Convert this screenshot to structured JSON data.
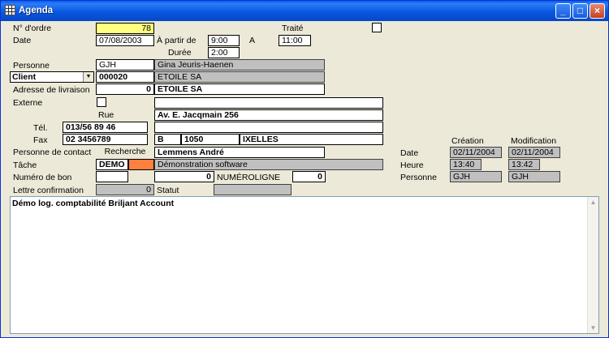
{
  "window": {
    "title": "Agenda"
  },
  "labels": {
    "order": "N° d'ordre",
    "traite": "Traité",
    "date": "Date",
    "a_partir": "À partir de",
    "a": "A",
    "duree": "Durée",
    "personne": "Personne",
    "adresse_livraison": "Adresse de livraison",
    "externe": "Externe",
    "rue": "Rue",
    "tel": "Tél.",
    "fax": "Fax",
    "contact": "Personne de contact",
    "tache": "Tâche",
    "num_bon": "Numéro de bon",
    "numeroligne": "NUMÉROLIGNE",
    "lettre": "Lettre confirmation",
    "statut": "Statut",
    "creation": "Création",
    "modification": "Modification",
    "meta_date": "Date",
    "meta_heure": "Heure",
    "meta_personne": "Personne"
  },
  "values": {
    "order": "78",
    "date": "07/08/2003",
    "from": "9:00",
    "to": "11:00",
    "duree": "2:00",
    "personne_code": "GJH",
    "personne_name": "Gina Jeuris-Haenen",
    "client_type": "Client",
    "client_code": "000020",
    "client_name": "ETOILE SA",
    "adresse_num": "0",
    "adresse_name": "ETOILE SA",
    "externe_text": "",
    "rue": "Av. E. Jacqmain 256",
    "rue2": "",
    "tel": "013/56 89 46",
    "tel_extra": "",
    "fax": "02 3456789",
    "country": "B",
    "postal": "1050",
    "city": "IXELLES",
    "recherche": "Recherche",
    "contact": "Lemmens André",
    "tache_code": "DEMO",
    "tache_desc": "Démonstration software",
    "num_bon": "",
    "num_bon_val": "0",
    "numeroligne": "0",
    "lettre": "0",
    "statut": ""
  },
  "meta": {
    "creation_date": "02/11/2004",
    "modification_date": "02/11/2004",
    "creation_heure": "13:40",
    "modification_heure": "13:42",
    "creation_personne": "GJH",
    "modification_personne": "GJH"
  },
  "notes": "Démo log. comptabilité Briljant Account",
  "colors": {
    "highlight": "#FFFF80",
    "tache_accent": "#FF7F3F",
    "titlebar": "#0A5FE6"
  }
}
